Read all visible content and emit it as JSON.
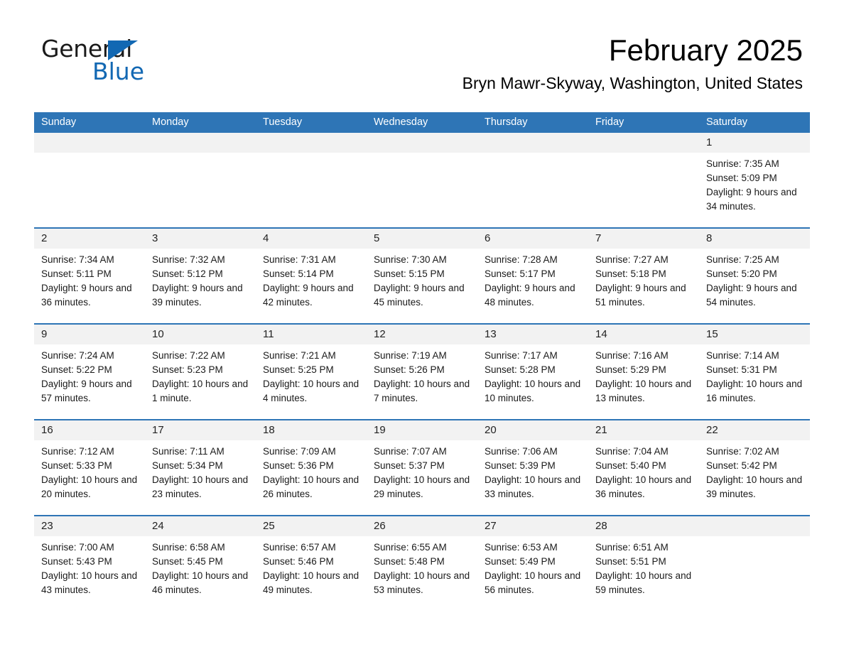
{
  "brand": {
    "name_part1": "General",
    "name_part2": "Blue",
    "triangle_icon": "triangle-icon",
    "accent_color": "#1268b3"
  },
  "header": {
    "title": "February 2025",
    "subtitle": "Bryn Mawr-Skyway, Washington, United States"
  },
  "theme": {
    "header_blue": "#2e75b6",
    "daynum_gray": "#f2f2f2",
    "text_black": "#1a1a1a"
  },
  "calendar": {
    "weekday_headers": [
      "Sunday",
      "Monday",
      "Tuesday",
      "Wednesday",
      "Thursday",
      "Friday",
      "Saturday"
    ],
    "weeks": [
      [
        {
          "day": "",
          "empty": true
        },
        {
          "day": "",
          "empty": true
        },
        {
          "day": "",
          "empty": true
        },
        {
          "day": "",
          "empty": true
        },
        {
          "day": "",
          "empty": true
        },
        {
          "day": "",
          "empty": true
        },
        {
          "day": "1",
          "sunrise": "Sunrise: 7:35 AM",
          "sunset": "Sunset: 5:09 PM",
          "daylight": "Daylight: 9 hours and 34 minutes."
        }
      ],
      [
        {
          "day": "2",
          "sunrise": "Sunrise: 7:34 AM",
          "sunset": "Sunset: 5:11 PM",
          "daylight": "Daylight: 9 hours and 36 minutes."
        },
        {
          "day": "3",
          "sunrise": "Sunrise: 7:32 AM",
          "sunset": "Sunset: 5:12 PM",
          "daylight": "Daylight: 9 hours and 39 minutes."
        },
        {
          "day": "4",
          "sunrise": "Sunrise: 7:31 AM",
          "sunset": "Sunset: 5:14 PM",
          "daylight": "Daylight: 9 hours and 42 minutes."
        },
        {
          "day": "5",
          "sunrise": "Sunrise: 7:30 AM",
          "sunset": "Sunset: 5:15 PM",
          "daylight": "Daylight: 9 hours and 45 minutes."
        },
        {
          "day": "6",
          "sunrise": "Sunrise: 7:28 AM",
          "sunset": "Sunset: 5:17 PM",
          "daylight": "Daylight: 9 hours and 48 minutes."
        },
        {
          "day": "7",
          "sunrise": "Sunrise: 7:27 AM",
          "sunset": "Sunset: 5:18 PM",
          "daylight": "Daylight: 9 hours and 51 minutes."
        },
        {
          "day": "8",
          "sunrise": "Sunrise: 7:25 AM",
          "sunset": "Sunset: 5:20 PM",
          "daylight": "Daylight: 9 hours and 54 minutes."
        }
      ],
      [
        {
          "day": "9",
          "sunrise": "Sunrise: 7:24 AM",
          "sunset": "Sunset: 5:22 PM",
          "daylight": "Daylight: 9 hours and 57 minutes."
        },
        {
          "day": "10",
          "sunrise": "Sunrise: 7:22 AM",
          "sunset": "Sunset: 5:23 PM",
          "daylight": "Daylight: 10 hours and 1 minute."
        },
        {
          "day": "11",
          "sunrise": "Sunrise: 7:21 AM",
          "sunset": "Sunset: 5:25 PM",
          "daylight": "Daylight: 10 hours and 4 minutes."
        },
        {
          "day": "12",
          "sunrise": "Sunrise: 7:19 AM",
          "sunset": "Sunset: 5:26 PM",
          "daylight": "Daylight: 10 hours and 7 minutes."
        },
        {
          "day": "13",
          "sunrise": "Sunrise: 7:17 AM",
          "sunset": "Sunset: 5:28 PM",
          "daylight": "Daylight: 10 hours and 10 minutes."
        },
        {
          "day": "14",
          "sunrise": "Sunrise: 7:16 AM",
          "sunset": "Sunset: 5:29 PM",
          "daylight": "Daylight: 10 hours and 13 minutes."
        },
        {
          "day": "15",
          "sunrise": "Sunrise: 7:14 AM",
          "sunset": "Sunset: 5:31 PM",
          "daylight": "Daylight: 10 hours and 16 minutes."
        }
      ],
      [
        {
          "day": "16",
          "sunrise": "Sunrise: 7:12 AM",
          "sunset": "Sunset: 5:33 PM",
          "daylight": "Daylight: 10 hours and 20 minutes."
        },
        {
          "day": "17",
          "sunrise": "Sunrise: 7:11 AM",
          "sunset": "Sunset: 5:34 PM",
          "daylight": "Daylight: 10 hours and 23 minutes."
        },
        {
          "day": "18",
          "sunrise": "Sunrise: 7:09 AM",
          "sunset": "Sunset: 5:36 PM",
          "daylight": "Daylight: 10 hours and 26 minutes."
        },
        {
          "day": "19",
          "sunrise": "Sunrise: 7:07 AM",
          "sunset": "Sunset: 5:37 PM",
          "daylight": "Daylight: 10 hours and 29 minutes."
        },
        {
          "day": "20",
          "sunrise": "Sunrise: 7:06 AM",
          "sunset": "Sunset: 5:39 PM",
          "daylight": "Daylight: 10 hours and 33 minutes."
        },
        {
          "day": "21",
          "sunrise": "Sunrise: 7:04 AM",
          "sunset": "Sunset: 5:40 PM",
          "daylight": "Daylight: 10 hours and 36 minutes."
        },
        {
          "day": "22",
          "sunrise": "Sunrise: 7:02 AM",
          "sunset": "Sunset: 5:42 PM",
          "daylight": "Daylight: 10 hours and 39 minutes."
        }
      ],
      [
        {
          "day": "23",
          "sunrise": "Sunrise: 7:00 AM",
          "sunset": "Sunset: 5:43 PM",
          "daylight": "Daylight: 10 hours and 43 minutes."
        },
        {
          "day": "24",
          "sunrise": "Sunrise: 6:58 AM",
          "sunset": "Sunset: 5:45 PM",
          "daylight": "Daylight: 10 hours and 46 minutes."
        },
        {
          "day": "25",
          "sunrise": "Sunrise: 6:57 AM",
          "sunset": "Sunset: 5:46 PM",
          "daylight": "Daylight: 10 hours and 49 minutes."
        },
        {
          "day": "26",
          "sunrise": "Sunrise: 6:55 AM",
          "sunset": "Sunset: 5:48 PM",
          "daylight": "Daylight: 10 hours and 53 minutes."
        },
        {
          "day": "27",
          "sunrise": "Sunrise: 6:53 AM",
          "sunset": "Sunset: 5:49 PM",
          "daylight": "Daylight: 10 hours and 56 minutes."
        },
        {
          "day": "28",
          "sunrise": "Sunrise: 6:51 AM",
          "sunset": "Sunset: 5:51 PM",
          "daylight": "Daylight: 10 hours and 59 minutes."
        },
        {
          "day": "",
          "empty": true
        }
      ]
    ]
  }
}
